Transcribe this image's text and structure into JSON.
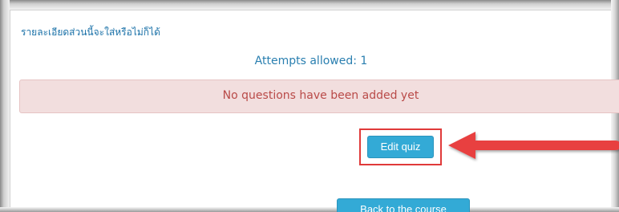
{
  "quiz": {
    "description_link": "รายละเอียดส่วนนี้จะใส่หรือไม่ก็ได้",
    "attempts_text": "Attempts allowed: 1",
    "alert_message": "No questions have been added yet",
    "edit_quiz_label": "Edit quiz",
    "back_label": "Back to the course"
  },
  "annotations": {
    "highlight_color": "#e03a3a",
    "arrow_icon": "left-arrow-icon"
  },
  "colors": {
    "button": "#33aad6",
    "alert_bg": "#f2dede",
    "alert_text": "#b94a48",
    "link": "#1a71a8"
  }
}
